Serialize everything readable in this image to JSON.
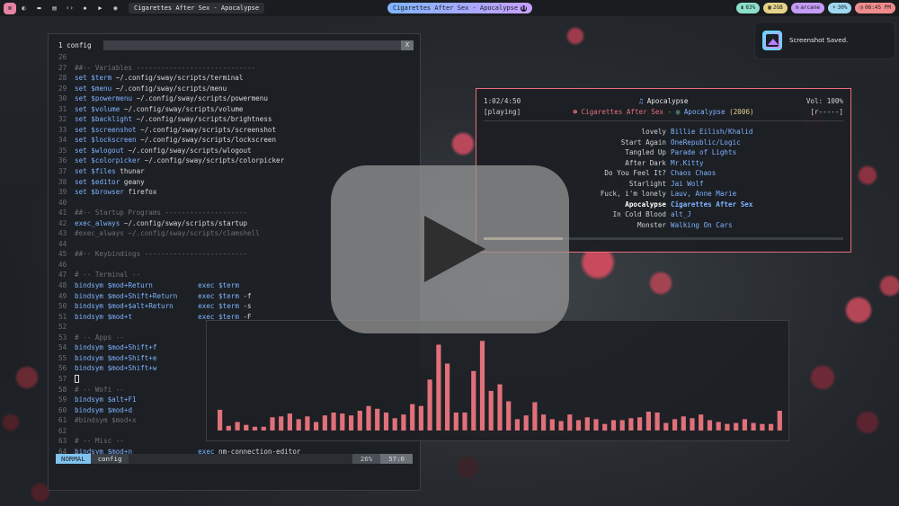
{
  "topbar": {
    "workspace_icons": [
      "terminal-icon",
      "folder-icon",
      "document-icon",
      "code-icon",
      "gear-icon",
      "video-icon",
      "github-icon"
    ],
    "window_title": "Cigarettes After Sex - Apocalypse",
    "now_playing": "Cigarettes After Sex - Apocalypse",
    "status": [
      {
        "label": "83%",
        "color": "#8be0c9"
      },
      {
        "label": "2GB",
        "color": "#e5d38a"
      },
      {
        "label": "arcane",
        "color": "#c49cf5"
      },
      {
        "label": "30%",
        "color": "#9fd8f0"
      },
      {
        "label": "06:45 PM",
        "color": "#f08c8c"
      }
    ]
  },
  "notification": {
    "text": "Screenshot Saved."
  },
  "editor": {
    "tab": "1 config",
    "close": "X",
    "lines": [
      {
        "n": "26",
        "parts": []
      },
      {
        "n": "27",
        "parts": [
          {
            "c": "com",
            "t": "##-- Variables -----------------------------"
          }
        ]
      },
      {
        "n": "28",
        "parts": [
          {
            "c": "kw",
            "t": "set "
          },
          {
            "c": "var",
            "t": "$term"
          },
          {
            "c": "plain",
            "t": " ~/.config/sway/scripts/terminal"
          }
        ]
      },
      {
        "n": "29",
        "parts": [
          {
            "c": "kw",
            "t": "set "
          },
          {
            "c": "var",
            "t": "$menu"
          },
          {
            "c": "plain",
            "t": " ~/.config/sway/scripts/menu"
          }
        ]
      },
      {
        "n": "30",
        "parts": [
          {
            "c": "kw",
            "t": "set "
          },
          {
            "c": "var",
            "t": "$powermenu"
          },
          {
            "c": "plain",
            "t": " ~/.config/sway/scripts/powermenu"
          }
        ]
      },
      {
        "n": "31",
        "parts": [
          {
            "c": "kw",
            "t": "set "
          },
          {
            "c": "var",
            "t": "$volume"
          },
          {
            "c": "plain",
            "t": " ~/.config/sway/scripts/volume"
          }
        ]
      },
      {
        "n": "32",
        "parts": [
          {
            "c": "kw",
            "t": "set "
          },
          {
            "c": "var",
            "t": "$backlight"
          },
          {
            "c": "plain",
            "t": " ~/.config/sway/scripts/brightness"
          }
        ]
      },
      {
        "n": "33",
        "parts": [
          {
            "c": "kw",
            "t": "set "
          },
          {
            "c": "var",
            "t": "$screenshot"
          },
          {
            "c": "plain",
            "t": " ~/.config/sway/scripts/screenshot"
          }
        ]
      },
      {
        "n": "34",
        "parts": [
          {
            "c": "kw",
            "t": "set "
          },
          {
            "c": "var",
            "t": "$lockscreen"
          },
          {
            "c": "plain",
            "t": " ~/.config/sway/scripts/lockscreen"
          }
        ]
      },
      {
        "n": "35",
        "parts": [
          {
            "c": "kw",
            "t": "set "
          },
          {
            "c": "var",
            "t": "$wlogout"
          },
          {
            "c": "plain",
            "t": " ~/.config/sway/scripts/wlogout"
          }
        ]
      },
      {
        "n": "36",
        "parts": [
          {
            "c": "kw",
            "t": "set "
          },
          {
            "c": "var",
            "t": "$colorpicker"
          },
          {
            "c": "plain",
            "t": " ~/.config/sway/scripts/colorpicker"
          }
        ]
      },
      {
        "n": "37",
        "parts": [
          {
            "c": "kw",
            "t": "set "
          },
          {
            "c": "var",
            "t": "$files"
          },
          {
            "c": "plain",
            "t": " thunar"
          }
        ]
      },
      {
        "n": "38",
        "parts": [
          {
            "c": "kw",
            "t": "set "
          },
          {
            "c": "var",
            "t": "$editor"
          },
          {
            "c": "plain",
            "t": " geany"
          }
        ]
      },
      {
        "n": "39",
        "parts": [
          {
            "c": "kw",
            "t": "set "
          },
          {
            "c": "var",
            "t": "$browser"
          },
          {
            "c": "plain",
            "t": " firefox"
          }
        ]
      },
      {
        "n": "40",
        "parts": []
      },
      {
        "n": "41",
        "parts": [
          {
            "c": "com",
            "t": "##-- Startup Programs --------------------"
          }
        ]
      },
      {
        "n": "42",
        "parts": [
          {
            "c": "kw",
            "t": "exec_always"
          },
          {
            "c": "plain",
            "t": " ~/.config/sway/scripts/startup"
          }
        ]
      },
      {
        "n": "43",
        "parts": [
          {
            "c": "com",
            "t": "#exec_always ~/.config/sway/scripts/clamshell"
          }
        ]
      },
      {
        "n": "44",
        "parts": []
      },
      {
        "n": "45",
        "parts": [
          {
            "c": "com",
            "t": "##-- Keybindings -------------------------"
          }
        ]
      },
      {
        "n": "46",
        "parts": []
      },
      {
        "n": "47",
        "parts": [
          {
            "c": "com",
            "t": "# -- Terminal --"
          }
        ]
      },
      {
        "n": "48",
        "parts": [
          {
            "c": "kw",
            "t": "bindsym "
          },
          {
            "c": "var",
            "t": "$mod"
          },
          {
            "c": "kw",
            "t": "+Return           "
          },
          {
            "c": "kw",
            "t": "exec "
          },
          {
            "c": "var",
            "t": "$term"
          }
        ]
      },
      {
        "n": "49",
        "parts": [
          {
            "c": "kw",
            "t": "bindsym "
          },
          {
            "c": "var",
            "t": "$mod"
          },
          {
            "c": "kw",
            "t": "+Shift+Return     "
          },
          {
            "c": "kw",
            "t": "exec "
          },
          {
            "c": "var",
            "t": "$term"
          },
          {
            "c": "plain",
            "t": " -f"
          }
        ]
      },
      {
        "n": "50",
        "parts": [
          {
            "c": "kw",
            "t": "bindsym "
          },
          {
            "c": "var",
            "t": "$mod"
          },
          {
            "c": "kw",
            "t": "+"
          },
          {
            "c": "var",
            "t": "$alt"
          },
          {
            "c": "kw",
            "t": "+Return      "
          },
          {
            "c": "kw",
            "t": "exec "
          },
          {
            "c": "var",
            "t": "$term"
          },
          {
            "c": "plain",
            "t": " -s"
          }
        ]
      },
      {
        "n": "51",
        "parts": [
          {
            "c": "kw",
            "t": "bindsym "
          },
          {
            "c": "var",
            "t": "$mod"
          },
          {
            "c": "kw",
            "t": "+t                "
          },
          {
            "c": "kw",
            "t": "exec "
          },
          {
            "c": "var",
            "t": "$term"
          },
          {
            "c": "plain",
            "t": " -F"
          }
        ]
      },
      {
        "n": "52",
        "parts": []
      },
      {
        "n": "53",
        "parts": [
          {
            "c": "com",
            "t": "# -- Apps --"
          }
        ]
      },
      {
        "n": "54",
        "parts": [
          {
            "c": "kw",
            "t": "bindsym "
          },
          {
            "c": "var",
            "t": "$mod"
          },
          {
            "c": "kw",
            "t": "+Shift+f"
          }
        ]
      },
      {
        "n": "55",
        "parts": [
          {
            "c": "kw",
            "t": "bindsym "
          },
          {
            "c": "var",
            "t": "$mod"
          },
          {
            "c": "kw",
            "t": "+Shift+e"
          }
        ]
      },
      {
        "n": "56",
        "parts": [
          {
            "c": "kw",
            "t": "bindsym "
          },
          {
            "c": "var",
            "t": "$mod"
          },
          {
            "c": "kw",
            "t": "+Shift+w"
          }
        ]
      },
      {
        "n": "57",
        "parts": [
          {
            "c": "cursor",
            "t": ""
          }
        ]
      },
      {
        "n": "58",
        "parts": [
          {
            "c": "com",
            "t": "# -- Wofi --"
          }
        ]
      },
      {
        "n": "59",
        "parts": [
          {
            "c": "kw",
            "t": "bindsym "
          },
          {
            "c": "var",
            "t": "$alt"
          },
          {
            "c": "kw",
            "t": "+F1"
          }
        ]
      },
      {
        "n": "60",
        "parts": [
          {
            "c": "kw",
            "t": "bindsym "
          },
          {
            "c": "var",
            "t": "$mod"
          },
          {
            "c": "kw",
            "t": "+d"
          }
        ]
      },
      {
        "n": "61",
        "parts": [
          {
            "c": "com",
            "t": "#bindsym $mod+x"
          }
        ]
      },
      {
        "n": "62",
        "parts": []
      },
      {
        "n": "63",
        "parts": [
          {
            "c": "com",
            "t": "# -- Misc --"
          }
        ]
      },
      {
        "n": "64",
        "parts": [
          {
            "c": "kw",
            "t": "bindsym "
          },
          {
            "c": "var",
            "t": "$mod"
          },
          {
            "c": "kw",
            "t": "+n                "
          },
          {
            "c": "kw",
            "t": "exec "
          },
          {
            "c": "plain",
            "t": "nm-connection-editor"
          }
        ]
      }
    ],
    "status": {
      "mode": "NORMAL",
      "file": "config",
      "percent": "26%",
      "position": "57:0"
    }
  },
  "player": {
    "time": "1:02/4:50",
    "state": "[playing]",
    "song": "Apocalypse",
    "artist": "Cigarettes After Sex",
    "dash": " - ",
    "album": "Apocalypse",
    "year": "(2006)",
    "volume": "Vol: 100%",
    "flags": "[r-----]",
    "progress": 0.22,
    "tracks": [
      {
        "title": "lovely",
        "artist": "Billie Eilish/Khalid"
      },
      {
        "title": "Start Again",
        "artist": "OneRepublic/Logic"
      },
      {
        "title": "Tangled Up",
        "artist": "Parade of Lights"
      },
      {
        "title": "After Dark",
        "artist": "Mr.Kitty"
      },
      {
        "title": "Do You Feel It?",
        "artist": "Chaos Chaos"
      },
      {
        "title": "Starlight",
        "artist": "Jai Wolf"
      },
      {
        "title": "Fuck, i'm lonely",
        "artist": "Lauv, Anne Marie"
      },
      {
        "title": "Apocalypse",
        "artist": "Cigarettes After Sex",
        "current": true
      },
      {
        "title": "In Cold Blood",
        "artist": "alt_J"
      },
      {
        "title": "Monster",
        "artist": "Walking On Cars"
      }
    ]
  },
  "visualizer": {
    "color": "#e0707a",
    "levels": [
      0.22,
      0.05,
      0.09,
      0.06,
      0.04,
      0.04,
      0.14,
      0.15,
      0.18,
      0.12,
      0.15,
      0.09,
      0.16,
      0.19,
      0.18,
      0.16,
      0.21,
      0.26,
      0.23,
      0.19,
      0.13,
      0.17,
      0.28,
      0.26,
      0.54,
      0.91,
      0.71,
      0.19,
      0.19,
      0.63,
      0.95,
      0.42,
      0.49,
      0.31,
      0.12,
      0.16,
      0.3,
      0.17,
      0.12,
      0.1,
      0.17,
      0.11,
      0.14,
      0.12,
      0.07,
      0.11,
      0.11,
      0.13,
      0.14,
      0.2,
      0.19,
      0.08,
      0.12,
      0.15,
      0.13,
      0.17,
      0.11,
      0.09,
      0.07,
      0.08,
      0.12,
      0.08,
      0.07,
      0.07,
      0.21
    ]
  },
  "overlay": {
    "icon": "play-icon"
  }
}
